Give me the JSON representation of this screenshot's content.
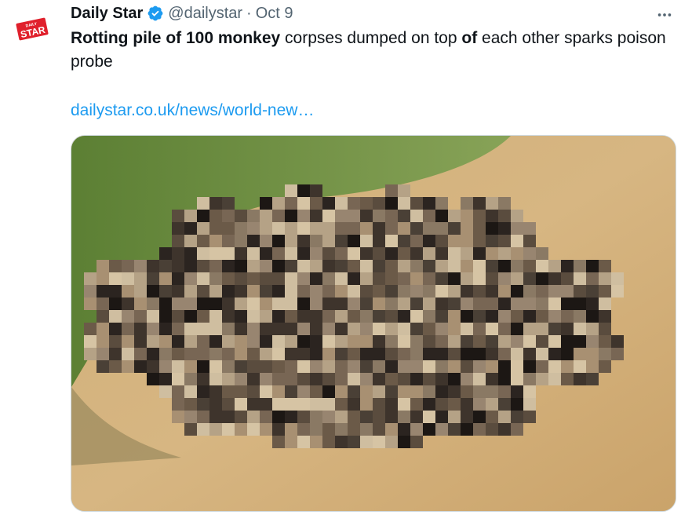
{
  "tweet": {
    "display_name": "Daily Star",
    "handle": "@dailystar",
    "separator": "·",
    "time": "Oct 9",
    "text_segments": [
      {
        "text": "Rotting pile of 100 monkey",
        "bold": true
      },
      {
        "text": " corpses dumped on top ",
        "bold": false
      },
      {
        "text": "of",
        "bold": true
      },
      {
        "text": " each other sparks poison probe",
        "bold": false
      }
    ],
    "link": "dailystar.co.uk/news/world-new…",
    "avatar_logo_text": "DAILY STAR",
    "verified": true
  },
  "icons": {
    "avatar": "daily-star-logo",
    "verified": "verified-badge-icon",
    "more": "more-options-icon"
  },
  "colors": {
    "accent": "#1d9bf0",
    "secondary_text": "#536471",
    "brand_red": "#e0202c"
  }
}
